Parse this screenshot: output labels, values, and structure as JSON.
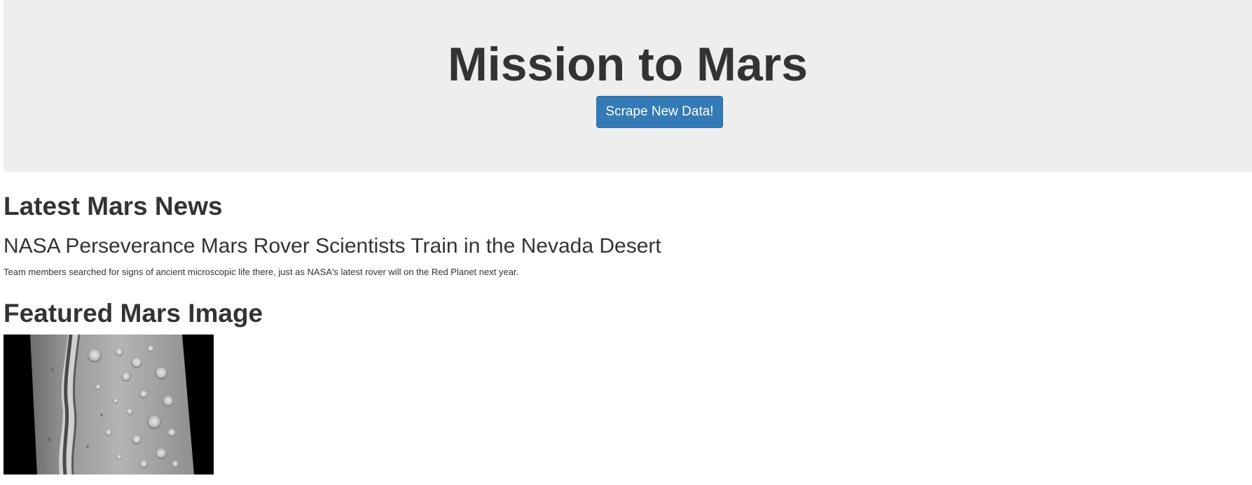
{
  "header": {
    "title": "Mission to Mars",
    "scrape_button_label": "Scrape New Data!"
  },
  "news": {
    "section_title": "Latest Mars News",
    "headline": "NASA Perseverance Mars Rover Scientists Train in the Nevada Desert",
    "teaser": "Team members searched for signs of ancient microscopic life there, just as NASA's latest rover will on the Red Planet next year."
  },
  "featured_image": {
    "section_title": "Featured Mars Image"
  },
  "colors": {
    "jumbotron_bg": "#eeeeee",
    "button_bg": "#337ab7",
    "text": "#333333"
  }
}
